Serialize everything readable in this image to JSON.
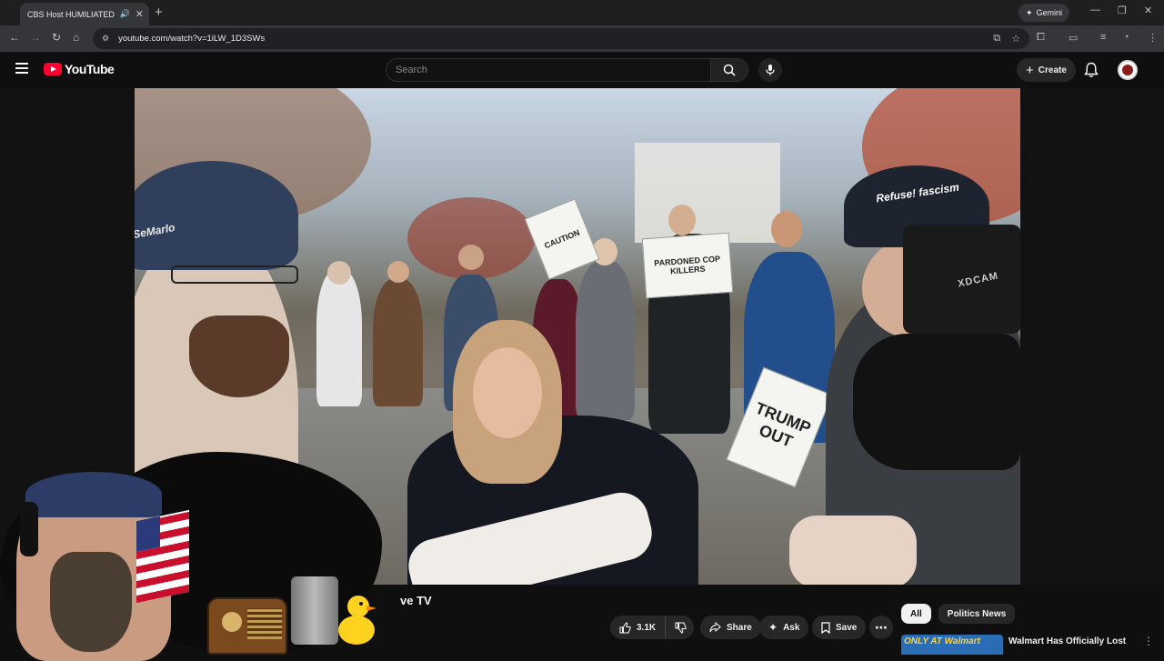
{
  "browser": {
    "tab_title": "CBS Host HUMILIATED Afte",
    "new_tab": "+",
    "gemini_label": "Gemini",
    "url": "youtube.com/watch?v=1iLW_1D3SWs"
  },
  "header": {
    "logo_text": "YouTube",
    "search_placeholder": "Search",
    "create_label": "Create"
  },
  "video": {
    "hat_text": "Refuse! fascism",
    "camera_brand": "XDCAM",
    "cap_text": "SeMarlo",
    "sign_1": "CAUTION",
    "sign_2": "PARDONED COP KILLERS",
    "sign_3": "TRUMP OUT"
  },
  "info": {
    "channel_fragment": "ve TV",
    "like_count": "3.1K",
    "share_label": "Share",
    "ask_label": "Ask",
    "save_label": "Save"
  },
  "chips": [
    "All",
    "Politics News"
  ],
  "recommendation": {
    "thumb_text": "ONLY AT Walmart",
    "title": "Walmart Has Officially Lost"
  }
}
